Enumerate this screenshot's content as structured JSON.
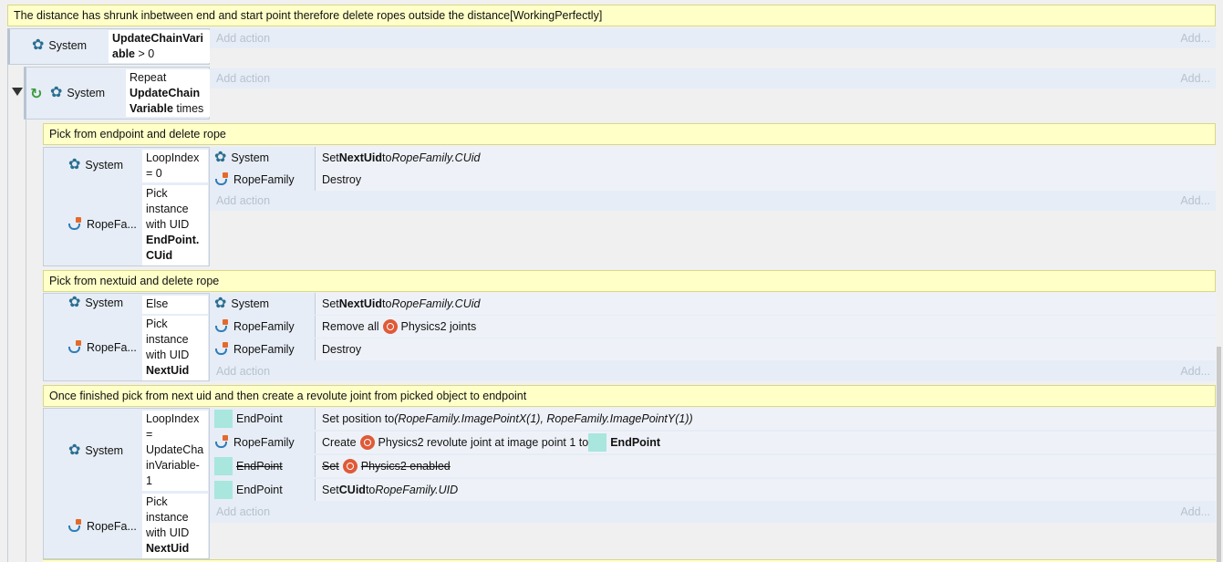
{
  "comments": {
    "top": "The distance has shrunk inbetween end and start point therefore delete ropes outside the distance[WorkingPerfectly]",
    "pick_endpoint": "Pick from endpoint and delete rope",
    "pick_nextuid": "Pick from nextuid and delete rope",
    "once_finished": "Once finished pick from next uid and then create a revolute joint from picked object to endpoint"
  },
  "labels": {
    "system": "System",
    "rope_family": "RopeFa...",
    "add_action": "Add action",
    "add": "Add..."
  },
  "event1": {
    "cond_var": "UpdateChainVari able",
    "cond_op": " > 0"
  },
  "event2": {
    "repeat": "Repeat",
    "var": "UpdateChain Variable",
    "times": " times"
  },
  "sub1": {
    "cond1": "LoopIndex = 0",
    "cond2_pre": "Pick instance with UID",
    "cond2_val": "EndPoint. CUid",
    "actions": [
      {
        "obj": "System",
        "pre": "Set ",
        "bold": "NextUid",
        "mid": " to ",
        "ital": "RopeFamily.CUid"
      },
      {
        "obj": "RopeFamily",
        "text": "Destroy"
      }
    ]
  },
  "sub2": {
    "cond1": "Else",
    "cond2_pre": "Pick instance with UID",
    "cond2_val": "NextUid",
    "actions": [
      {
        "obj": "System",
        "pre": "Set ",
        "bold": "NextUid",
        "mid": " to ",
        "ital": "RopeFamily.CUid"
      },
      {
        "obj": "RopeFamily",
        "pre": "Remove all ",
        "post": " Physics2 joints"
      },
      {
        "obj": "RopeFamily",
        "text": "Destroy"
      }
    ]
  },
  "sub3": {
    "cond1": "LoopIndex = UpdateCha inVariable- 1",
    "cond2_pre": "Pick instance with UID",
    "cond2_val": "NextUid",
    "actions": [
      {
        "obj": "EndPoint",
        "pre": "Set position to ",
        "ital": "(RopeFamily.ImagePointX(1), RopeFamily.ImagePointY(1))"
      },
      {
        "obj": "RopeFamily",
        "pre": "Create ",
        "mid": " Physics2 revolute joint at image point 1 to ",
        "bold": "EndPoint"
      },
      {
        "obj": "EndPoint",
        "pre": "Set ",
        "post": " Physics2 enabled"
      },
      {
        "obj": "EndPoint",
        "pre": "Set ",
        "bold": "CUid",
        "mid": " to ",
        "ital": "RopeFamily.UID"
      }
    ]
  }
}
